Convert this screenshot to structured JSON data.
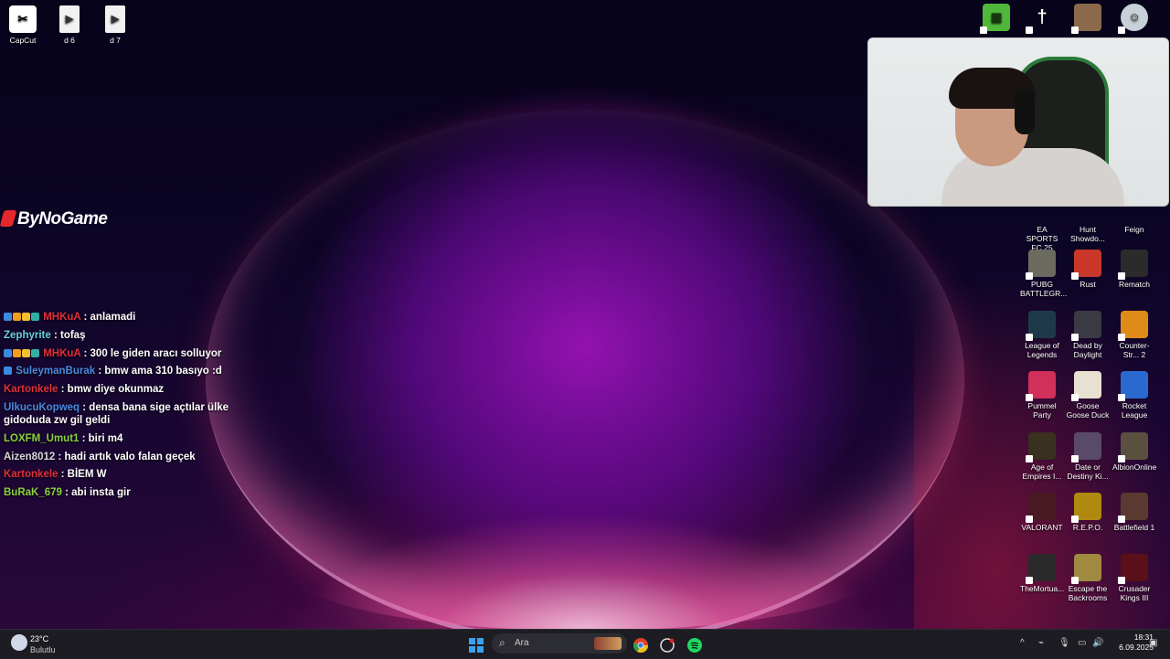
{
  "desktop_top_left": [
    {
      "label": "CapCut",
      "icon": "capcut-icon"
    },
    {
      "label": "d 6",
      "icon": "video-file-icon"
    },
    {
      "label": "d 7",
      "icon": "video-file-icon"
    }
  ],
  "desktop_top_right_icons": [
    "minecraft-icon",
    "sword-icon",
    "game-portrait-icon",
    "steam-ghost-icon"
  ],
  "desktop_right": [
    {
      "label": "EA SPORTS FC 25",
      "icon": "ea-fc-icon",
      "color": "#1a3a2a"
    },
    {
      "label": "Hunt Showdo...",
      "icon": "hunt-showdown-icon",
      "color": "#2a2018"
    },
    {
      "label": "Feign",
      "icon": "feign-icon",
      "color": "#c0202a"
    },
    {
      "label": "PUBG BATTLEGR...",
      "icon": "pubg-icon",
      "color": "#6b6b60"
    },
    {
      "label": "Rust",
      "icon": "rust-icon",
      "color": "#c8372a"
    },
    {
      "label": "Rematch",
      "icon": "rematch-icon",
      "color": "#2b2b2b"
    },
    {
      "label": "League of Legends",
      "icon": "league-icon",
      "color": "#1e3a4a"
    },
    {
      "label": "Dead by Daylight",
      "icon": "dbd-icon",
      "color": "#3a3a44"
    },
    {
      "label": "Counter-Str... 2",
      "icon": "cs2-icon",
      "color": "#e08a1a"
    },
    {
      "label": "Pummel Party",
      "icon": "pummel-party-icon",
      "color": "#d0305a"
    },
    {
      "label": "Goose Goose Duck",
      "icon": "goose-icon",
      "color": "#e8e0d0"
    },
    {
      "label": "Rocket League",
      "icon": "rocket-league-icon",
      "color": "#2a6ad0"
    },
    {
      "label": "Age of Empires I...",
      "icon": "aoe-icon",
      "color": "#3a3020"
    },
    {
      "label": "Date or Destiny Ki...",
      "icon": "date-destiny-icon",
      "color": "#5a4a6a"
    },
    {
      "label": "AlbionOnline",
      "icon": "albion-icon",
      "color": "#5a5040"
    },
    {
      "label": "VALORANT",
      "icon": "valorant-icon",
      "color": "#4a1a22"
    },
    {
      "label": "R.E.P.O.",
      "icon": "repo-icon",
      "color": "#b08a10"
    },
    {
      "label": "Battlefield 1",
      "icon": "battlefield-icon",
      "color": "#5a3a30"
    },
    {
      "label": "TheMortua...",
      "icon": "mortuary-icon",
      "color": "#2a2a2a"
    },
    {
      "label": "Escape the Backrooms",
      "icon": "backrooms-icon",
      "color": "#a08a40"
    },
    {
      "label": "Crusader Kings III",
      "icon": "ck3-icon",
      "color": "#5a1018"
    }
  ],
  "overlay_logo": "ByNoGame",
  "chat": [
    {
      "user": "MHKuA",
      "color": "#e0303a",
      "text": ": anlamadi",
      "badges": 4
    },
    {
      "user": "Zephyrite",
      "color": "#6ad0e0",
      "text": ": tofaş",
      "badges": 0
    },
    {
      "user": "MHKuA",
      "color": "#e0303a",
      "text": ": 300 le giden aracı solluyor",
      "badges": 4
    },
    {
      "user": "SuleymanBurak",
      "color": "#4a8ae0",
      "text": ": bmw ama 310 basıyo :d",
      "badges": 1
    },
    {
      "user": "Kartonkele",
      "color": "#e0303a",
      "text": ": bmw diye okunmaz",
      "badges": 0
    },
    {
      "user": "UlkucuKopweq",
      "color": "#4a8ae0",
      "text": ": densa bana sige açtılar ülke gidoduda zw gil geldi",
      "badges": 0
    },
    {
      "user": "LOXFM_Umut1",
      "color": "#8ad040",
      "text": ": biri m4",
      "badges": 0
    },
    {
      "user": "Aizen8012",
      "color": "#d8d8d8",
      "text": ": hadi artık valo falan geçek",
      "badges": 0
    },
    {
      "user": "Kartonkele",
      "color": "#e0303a",
      "text": ": BİEM W",
      "badges": 0
    },
    {
      "user": "BuRaK_679",
      "color": "#8ad040",
      "text": ": abi insta gir",
      "badges": 0
    }
  ],
  "taskbar": {
    "weather_temp": "23°C",
    "weather_desc": "Bulutlu",
    "search_placeholder": "Ara",
    "time": "18:31",
    "date": "6.09.2025"
  }
}
